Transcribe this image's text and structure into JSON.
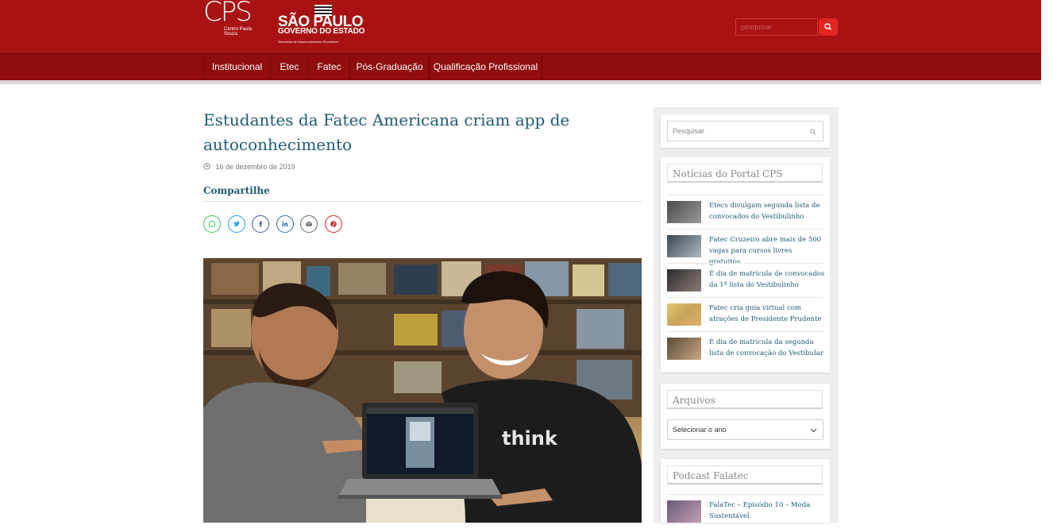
{
  "header": {
    "cps_logo": {
      "mark": "CPS",
      "sub": "Centro Paula Souza"
    },
    "sp_logo": {
      "line1": "SÃO PAULO",
      "line2": "GOVERNO DO ESTADO",
      "line3": "Secretaria de Desenvolvimento Econômico"
    },
    "search_placeholder": "pesquisar",
    "search_button_icon": "search-icon"
  },
  "nav": {
    "items": [
      {
        "label": "Institucional"
      },
      {
        "label": "Etec"
      },
      {
        "label": "Fatec"
      },
      {
        "label": "Pós-Graduação"
      },
      {
        "label": "Qualificação Profissional"
      }
    ]
  },
  "article": {
    "title": "Estudantes da Fatec Americana criam app de autoconhecimento",
    "date": "16 de dezembro de 2019",
    "share_heading": "Compartilhe",
    "share_icons": [
      {
        "icon": "whatsapp-icon",
        "color": "#3fbf5f"
      },
      {
        "icon": "twitter-icon",
        "color": "#1ea1e8"
      },
      {
        "icon": "facebook-icon",
        "color": "#3b5998"
      },
      {
        "icon": "linkedin-icon",
        "color": "#2d6aa8"
      },
      {
        "icon": "email-icon",
        "color": "#666666"
      },
      {
        "icon": "pinterest-icon",
        "color": "#cc2127"
      }
    ],
    "image_alt": "Dois estudantes sorrindo ao lado de um laptop",
    "shirt_text": "think"
  },
  "sidebar": {
    "search_placeholder": "Pesquisar",
    "news_title": "Notícias do Portal CPS",
    "news": [
      {
        "text": "Etecs divulgam segunda lista de convocados do Vestibulinho"
      },
      {
        "text": "Fatec Cruzeiro abre mais de 500 vagas para cursos livres gratuitos"
      },
      {
        "text": "É dia de matrícula de convocados da 1ª lista do Vestibulinho"
      },
      {
        "text": "Fatec cria guia virtual com atrações de Presidente Prudente"
      },
      {
        "text": "É dia de matrícula da segunda lista de convocação do Vestibular"
      }
    ],
    "archives_title": "Arquivos",
    "archives_select": "Selecionar o ano",
    "podcast_title": "Podcast Falatec",
    "podcast_item": "FalaTec – Episódio 10 – Moda Sustentável"
  },
  "colors": {
    "brand_red": "#a81212",
    "nav_red": "#8f0d0d",
    "link_blue": "#1f5a73"
  }
}
